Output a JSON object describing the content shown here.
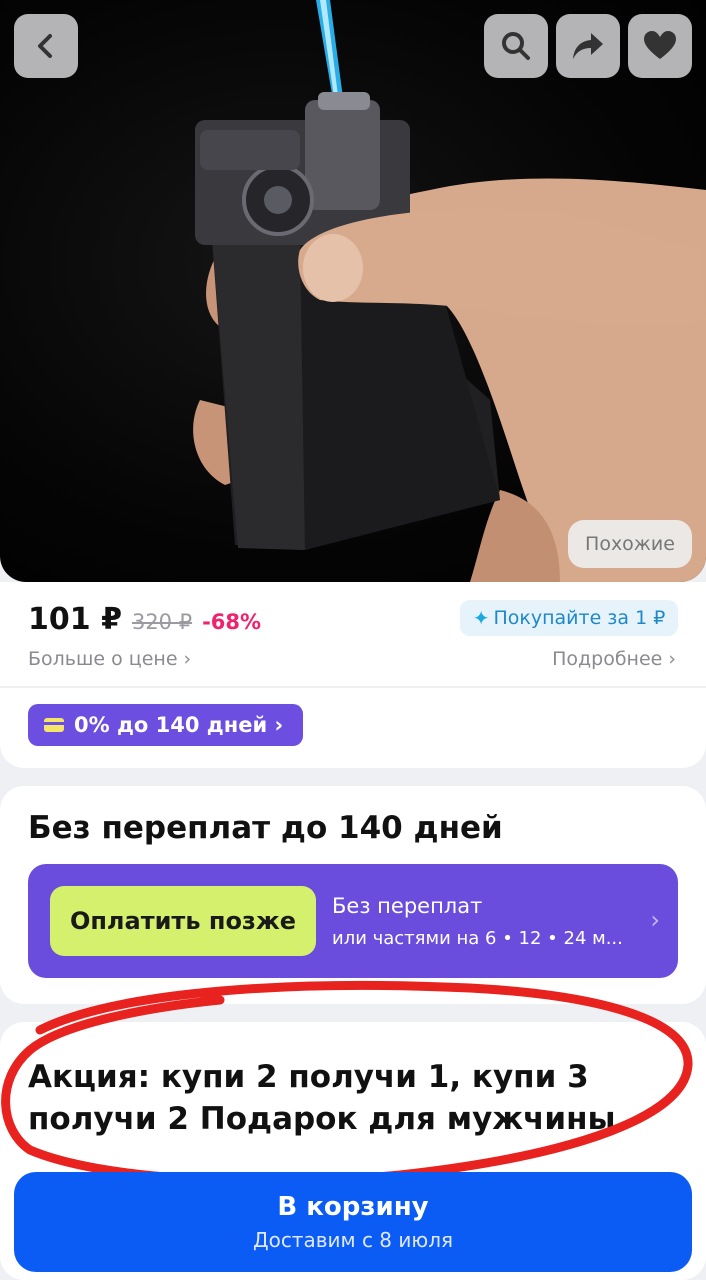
{
  "price": {
    "current": "101 ₽",
    "old": "320 ₽",
    "discount": "-68%",
    "more_link": "Больше о цене ›",
    "buy_for": "Покупайте за 1 ₽",
    "details_link": "Подробнее ›"
  },
  "hero": {
    "similar_label": "Похожие"
  },
  "installment": {
    "chip_label": "0% до 140 дней ›"
  },
  "pay_later": {
    "title": "Без переплат до 140 дней",
    "button_label": "Оплатить позже",
    "line1": "Без переплат",
    "line2": "или частями на 6 • 12 • 24 м...",
    "chevron": "›"
  },
  "promo": {
    "text": "Акция: купи 2 получи 1, купи 3 получи 2 Подарок для мужчины"
  },
  "cart": {
    "title": "В корзину",
    "subtitle": "Доставим с 8 июля"
  },
  "icons": [
    "chevron-left-icon",
    "search-icon",
    "share-icon",
    "heart-icon"
  ],
  "colors": {
    "accent_purple": "#6b4ddd",
    "accent_lime": "#d4f06c",
    "cart_blue": "#0a5cf5",
    "discount_pink": "#f0226e",
    "annotation_red": "#e8231f"
  }
}
